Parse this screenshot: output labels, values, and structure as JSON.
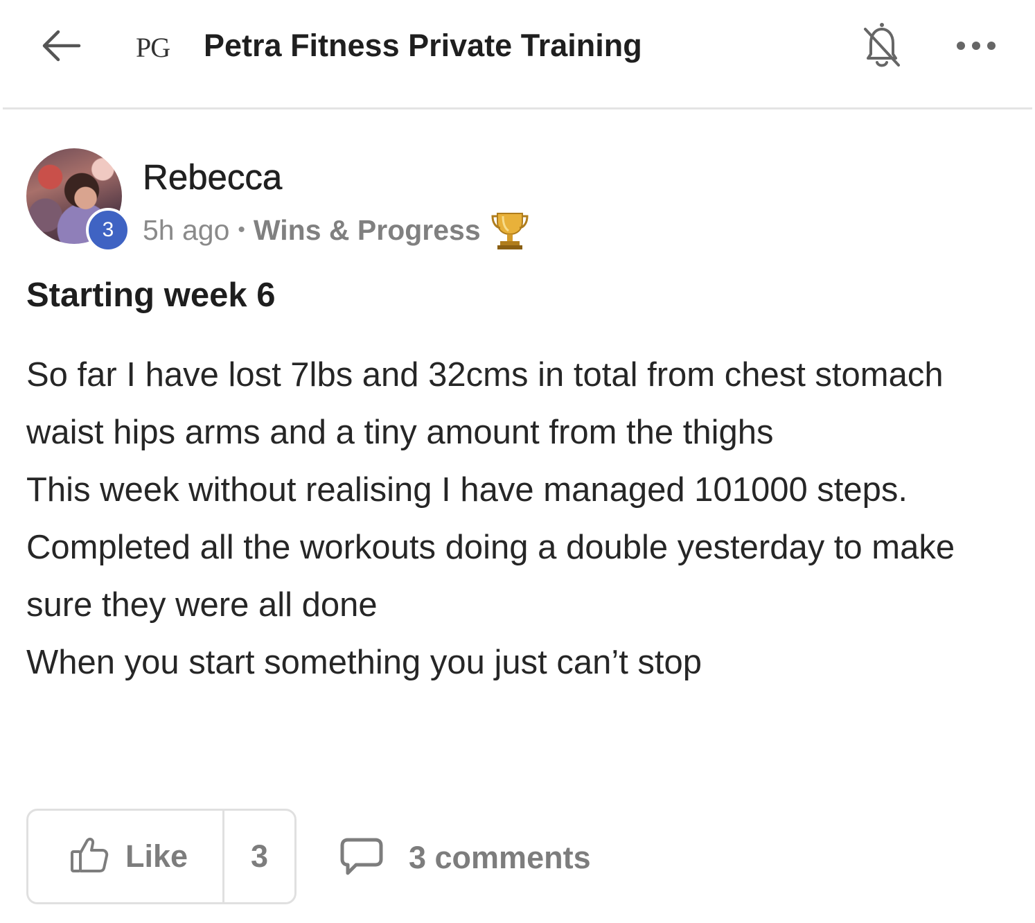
{
  "header": {
    "back_icon": "arrow-left-icon",
    "group_logo_text": "PG",
    "group_title": "Petra Fitness Private Training",
    "notifications_icon": "bell-off-icon",
    "more_icon": "more-horizontal-icon"
  },
  "post": {
    "author": {
      "name": "Rebecca",
      "level": "3",
      "avatar_icon": "user-avatar"
    },
    "time": "5h ago",
    "meta_separator": "•",
    "category": "Wins & Progress",
    "category_icon": "trophy-icon",
    "title": "Starting week 6",
    "body": {
      "p1": "So far I have lost 7lbs and 32cms in total from chest stomach waist hips arms and a tiny amount from the thighs",
      "p2": "This week without realising I have managed 101000 steps. Completed all the workouts doing a double yesterday to make sure they were all done",
      "p3": "When you start something you just can’t stop"
    }
  },
  "actions": {
    "like_icon": "thumbs-up-icon",
    "like_label": "Like",
    "like_count": "3",
    "comment_icon": "comment-icon",
    "comments_label": "3 comments"
  },
  "colors": {
    "badge_blue": "#3f63c3",
    "text_primary": "#222222",
    "text_muted": "#8a8a8a",
    "border": "#e0e0e0",
    "trophy_gold": "#e8b13a"
  }
}
